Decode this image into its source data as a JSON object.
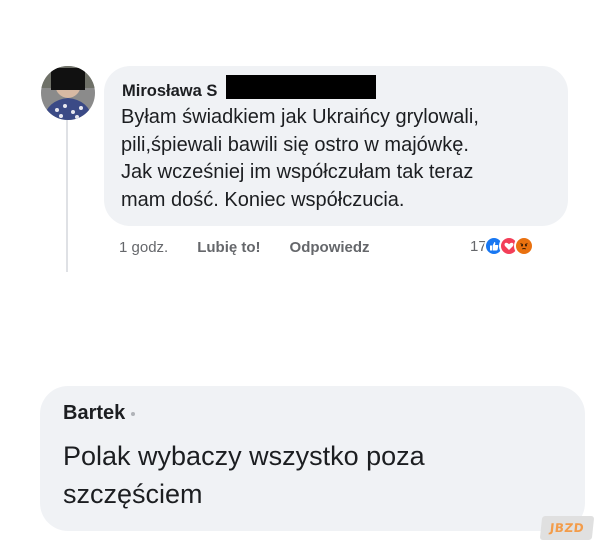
{
  "top_comment": {
    "author": "Mirosława S",
    "text_lines": [
      "Byłam świadkiem jak Ukraińcy grylowali,",
      "pili,śpiewali bawili się ostro w majówkę.",
      "Jak wcześniej im współczułam tak teraz",
      "mam dość. Koniec współczucia."
    ],
    "actions": {
      "time": "1 godz.",
      "like": "Lubię to!",
      "reply": "Odpowiedz"
    },
    "reaction_count": "17",
    "reaction_icons": [
      "like-icon",
      "love-icon",
      "angry-icon"
    ],
    "colors": {
      "like": "#1877f2",
      "love": "#f33e58",
      "angry": "#e9710f"
    }
  },
  "bottom_comment": {
    "author": "Bartek",
    "text_lines": [
      "Polak wybaczy wszystko poza",
      "szczęściem"
    ]
  },
  "watermark": {
    "text": "JBZD"
  }
}
